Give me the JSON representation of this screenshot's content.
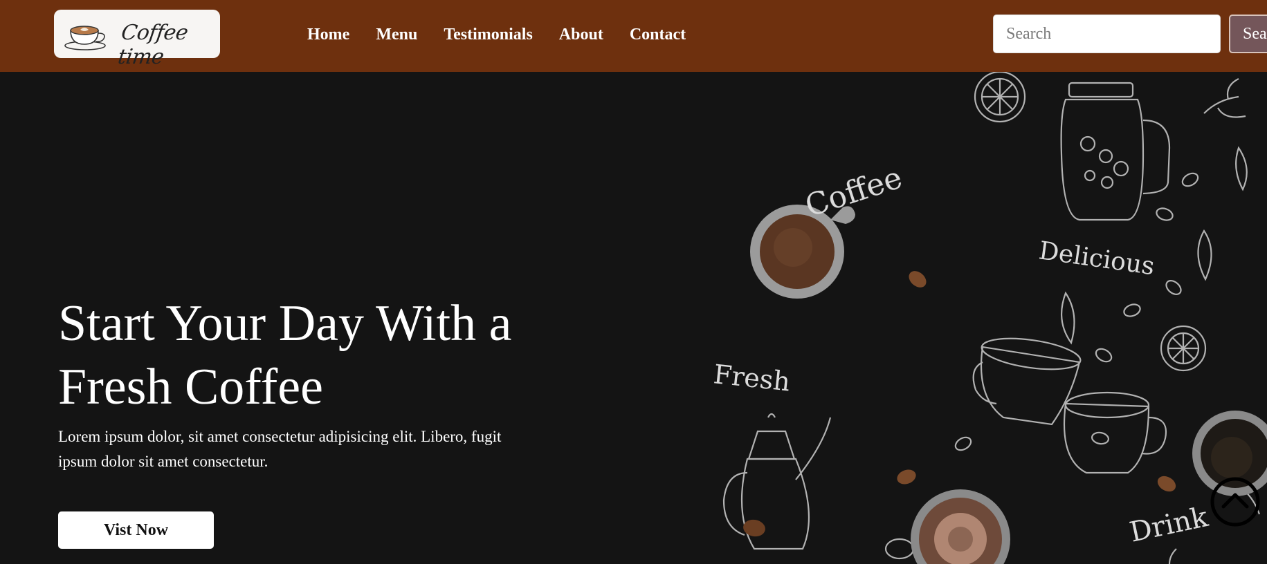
{
  "navbar": {
    "logo_text": "Coffee time",
    "links": [
      "Home",
      "Menu",
      "Testimonials",
      "About",
      "Contact"
    ],
    "search_placeholder": "Search",
    "search_button_label": "Search"
  },
  "hero": {
    "title_line1": "Start Your Day With a",
    "title_line2": "Fresh Coffee",
    "text": "Lorem ipsum dolor, sit amet consectetur adipisicing elit. Libero, fugit ipsum dolor sit amet consectetur.",
    "button_label": "Vist Now",
    "art_words": [
      "Coffee",
      "Delicious",
      "Fresh",
      "Drink"
    ]
  },
  "colors": {
    "navbar_bg": "#6e300e",
    "hero_bg": "#141414",
    "search_button_bg": "#74565a"
  },
  "icons": {
    "logo": "coffee-cup-icon",
    "scroll_top": "chevron-up-circle-icon"
  }
}
